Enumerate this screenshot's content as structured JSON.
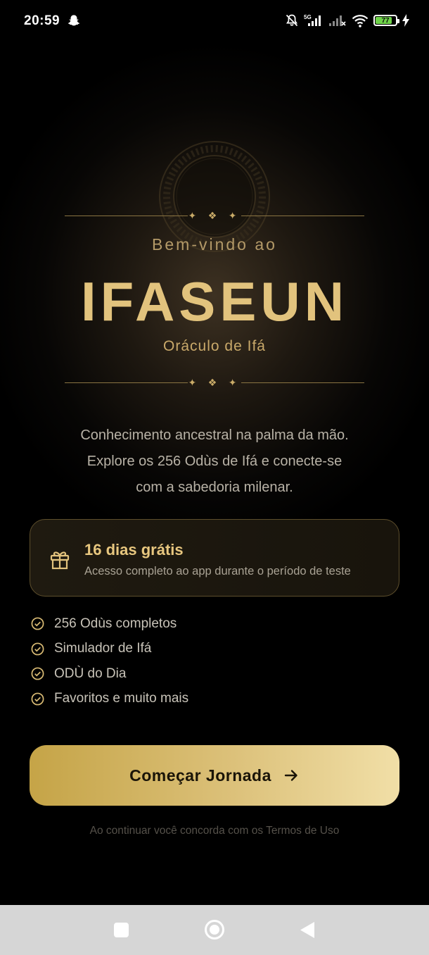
{
  "status_bar": {
    "time": "20:59",
    "network": "5G",
    "battery": "77"
  },
  "hero": {
    "welcome": "Bem-vindo ao",
    "brand": "IFASEUN",
    "tagline": "Oráculo de Ifá",
    "ornament": "✦ ❖ ✦"
  },
  "description": {
    "line1": "Conhecimento ancestral na palma da mão.",
    "line2": "Explore os 256 Odùs de Ifá e conecte-se",
    "line3": "com a sabedoria milenar."
  },
  "trial": {
    "title": "16 dias grátis",
    "subtitle": "Acesso completo ao app durante o período de teste"
  },
  "features": [
    {
      "label": "256 Odùs completos"
    },
    {
      "label": "Simulador de Ifá"
    },
    {
      "label": "ODÙ do Dia"
    },
    {
      "label": "Favoritos e muito mais"
    }
  ],
  "cta": {
    "label": "Começar Jornada"
  },
  "terms": "Ao continuar você concorda com os Termos de Uso",
  "colors": {
    "gold": "#e2c37d",
    "gold_dark": "#c5a447",
    "battery_green": "#6fd34a"
  }
}
